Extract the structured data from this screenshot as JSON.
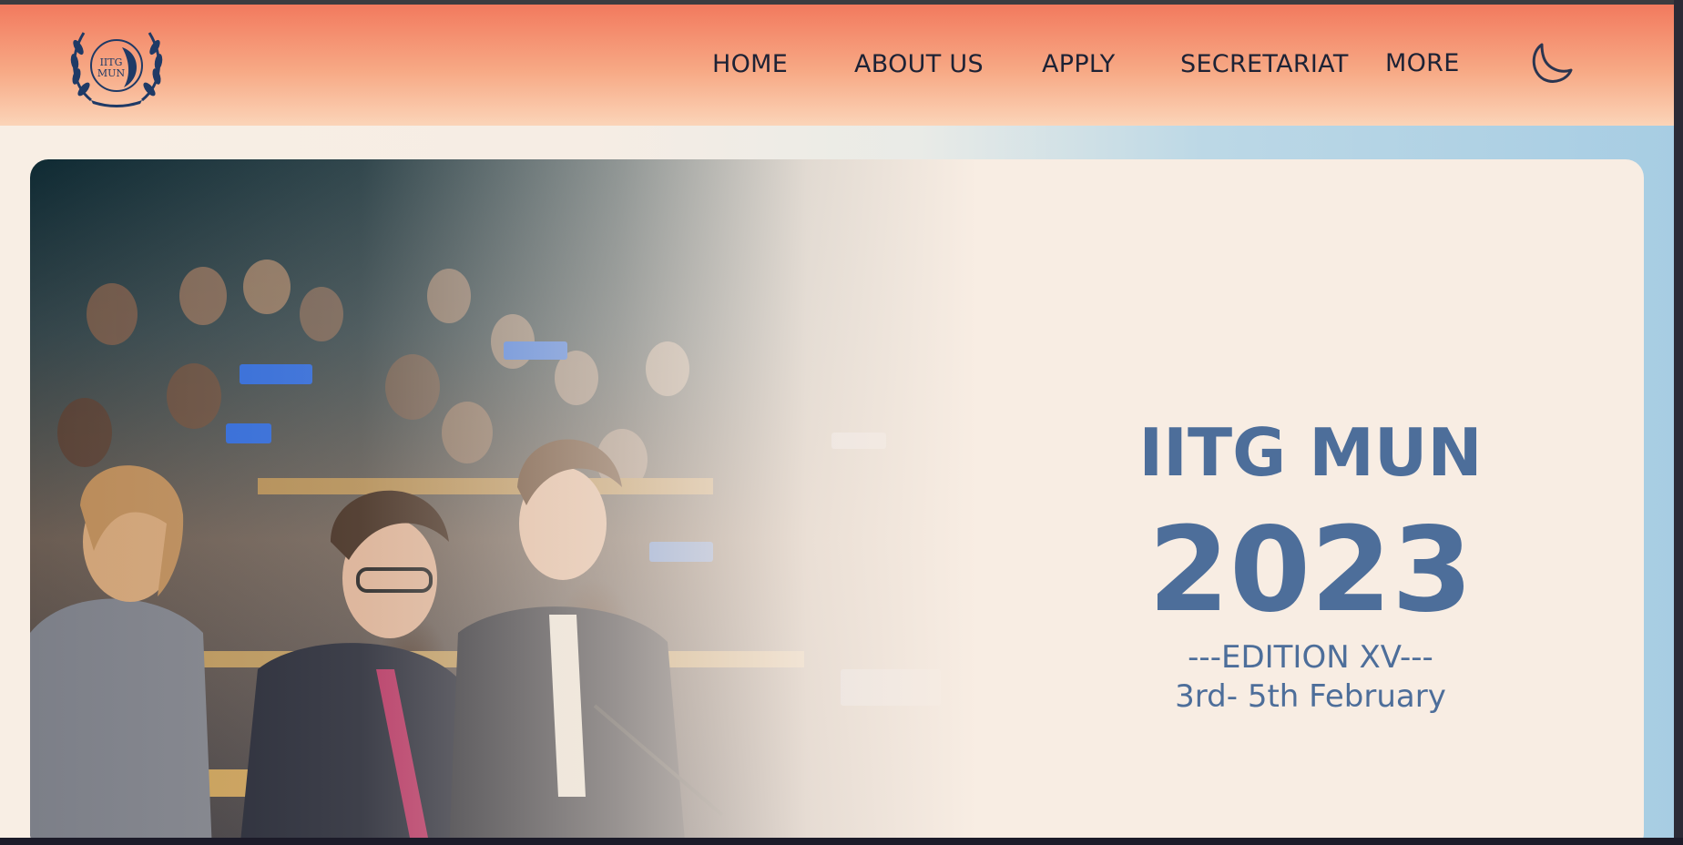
{
  "logo": {
    "text": "IITG MUN",
    "icon": "laurel-emblem-icon"
  },
  "nav": {
    "items": [
      {
        "label": "HOME"
      },
      {
        "label": "ABOUT US"
      },
      {
        "label": "APPLY"
      },
      {
        "label": "SECRETARIAT"
      },
      {
        "label": "MORE"
      }
    ],
    "theme_toggle_icon": "moon-icon"
  },
  "hero": {
    "image": "delegates-photo",
    "title": "IITG MUN",
    "year": "2023",
    "edition": "---EDITION XV---",
    "dates": "3rd- 5th February"
  },
  "colors": {
    "navbar_top": "#f27a5e",
    "navbar_bottom": "#fbd4b8",
    "hero_bg": "#f8ede3",
    "hero_text": "#4d6e9a",
    "nav_text": "#1d2235"
  }
}
